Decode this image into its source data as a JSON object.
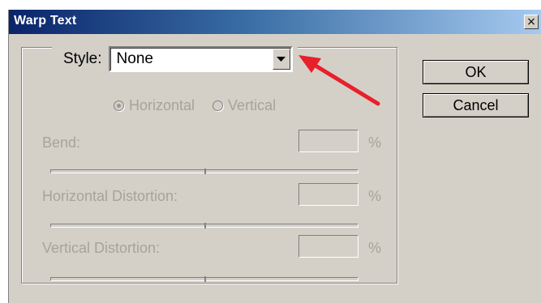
{
  "window": {
    "title": "Warp Text",
    "close_glyph": "×"
  },
  "style": {
    "label": "Style:",
    "selected_value": "None"
  },
  "orientation": {
    "horizontal_label": "Horizontal",
    "vertical_label": "Vertical",
    "selected": "Horizontal"
  },
  "fields": {
    "bend_label": "Bend:",
    "bend_unit": "%",
    "horizontal_distortion_label": "Horizontal Distortion:",
    "horizontal_distortion_unit": "%",
    "vertical_distortion_label": "Vertical Distortion:",
    "vertical_distortion_unit": "%"
  },
  "buttons": {
    "ok_label": "OK",
    "cancel_label": "Cancel"
  },
  "colors": {
    "title_bar_start": "#0a246a",
    "title_bar_end": "#a6caf0",
    "dialog_background": "#d4d0c8",
    "disabled_text": "#a6a39b",
    "annotation_arrow": "#e8202a"
  },
  "icons": {
    "dropdown": "chevron-down-icon",
    "close": "close-icon",
    "annotation": "red-arrow-annotation"
  }
}
